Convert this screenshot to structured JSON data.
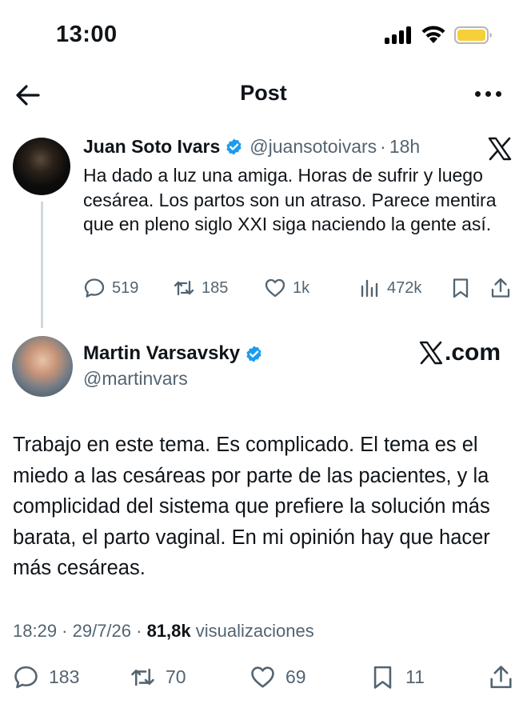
{
  "status_bar": {
    "time": "13:00"
  },
  "header": {
    "title": "Post",
    "back_icon": "arrow-left-icon",
    "more_icon": "more-dots-icon"
  },
  "quoted_tweet": {
    "display_name": "Juan Soto Ivars",
    "handle": "@juansotoivars",
    "separator": "·",
    "time": "18h",
    "text": "Ha dado a luz una amiga. Horas de sufrir y luego cesárea. Los partos son un atraso. Parece mentira que en pleno siglo XXI siga naciendo la gente así.",
    "actions": {
      "replies": "519",
      "reposts": "185",
      "likes": "1k",
      "views": "472k"
    }
  },
  "main_tweet": {
    "display_name": "Martin Varsavsky",
    "handle": "@martinvars",
    "brand_text": ".com",
    "text": "Trabajo en este tema. Es complicado. El tema es el miedo a las cesáreas por parte de las pacientes, y la complicidad del sistema que prefiere la solución más barata, el parto vaginal. En mi opinión hay que hacer más cesáreas.",
    "timestamp": "18:29 · 29/7/26 · ",
    "views_count": "81,8k",
    "views_label": " visualizaciones",
    "actions": {
      "replies": "183",
      "reposts": "70",
      "likes": "69",
      "bookmarks": "11"
    }
  },
  "colors": {
    "verified": "#1d9bf0",
    "muted": "#536471",
    "text": "#0f1419",
    "battery": "#f5d03a"
  }
}
